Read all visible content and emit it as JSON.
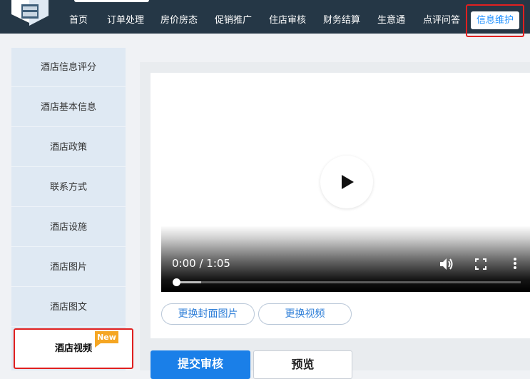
{
  "nav": {
    "items": [
      {
        "label": "首页"
      },
      {
        "label": "订单处理"
      },
      {
        "label": "房价房态"
      },
      {
        "label": "促销推广"
      },
      {
        "label": "住店审核"
      },
      {
        "label": "财务结算"
      },
      {
        "label": "生意通"
      },
      {
        "label": "点评问答"
      }
    ],
    "active_label": "信息维护"
  },
  "sidebar": {
    "items": [
      {
        "label": "酒店信息评分"
      },
      {
        "label": "酒店基本信息"
      },
      {
        "label": "酒店政策"
      },
      {
        "label": "联系方式"
      },
      {
        "label": "酒店设施"
      },
      {
        "label": "酒店图片"
      },
      {
        "label": "酒店图文"
      }
    ],
    "active_label": "酒店视频",
    "active_badge": "New"
  },
  "video": {
    "time_display": "0:00 / 1:05",
    "progress": 0
  },
  "actions": {
    "change_cover": "更换封面图片",
    "change_video": "更换视频",
    "submit": "提交审核",
    "preview": "预览"
  },
  "colors": {
    "topbar": "#253746",
    "accent": "#1a7fe8",
    "highlight": "#e02020",
    "badge": "#f5a623"
  }
}
